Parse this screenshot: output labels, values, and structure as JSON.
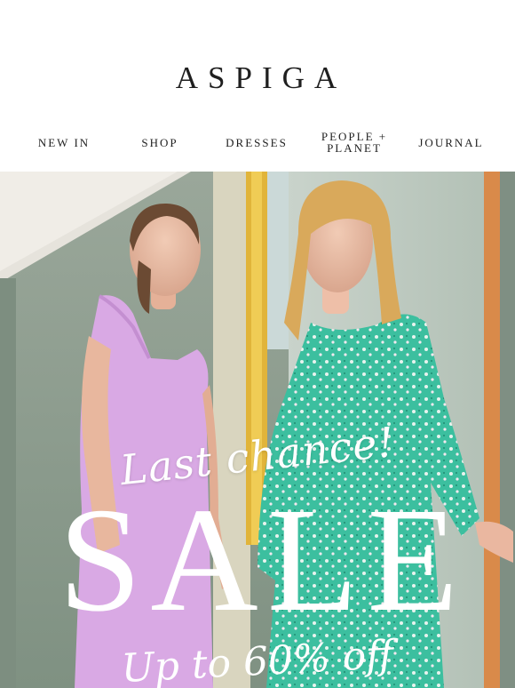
{
  "brand": {
    "name": "ASPIGA"
  },
  "nav": {
    "items": [
      {
        "label": "NEW IN"
      },
      {
        "label": "SHOP"
      },
      {
        "label": "DRESSES"
      },
      {
        "label": "PEOPLE + PLANET"
      },
      {
        "label": "JOURNAL"
      }
    ]
  },
  "hero": {
    "headline_script": "Last chance!",
    "headline_main": "SALE",
    "subline": "Up to 60% off"
  },
  "colors": {
    "text": "#1f1f1f",
    "background": "#ffffff",
    "overlay_text": "#ffffff",
    "lilac_dress": "#d7a7e2",
    "green_dress": "#3fc0a2"
  }
}
